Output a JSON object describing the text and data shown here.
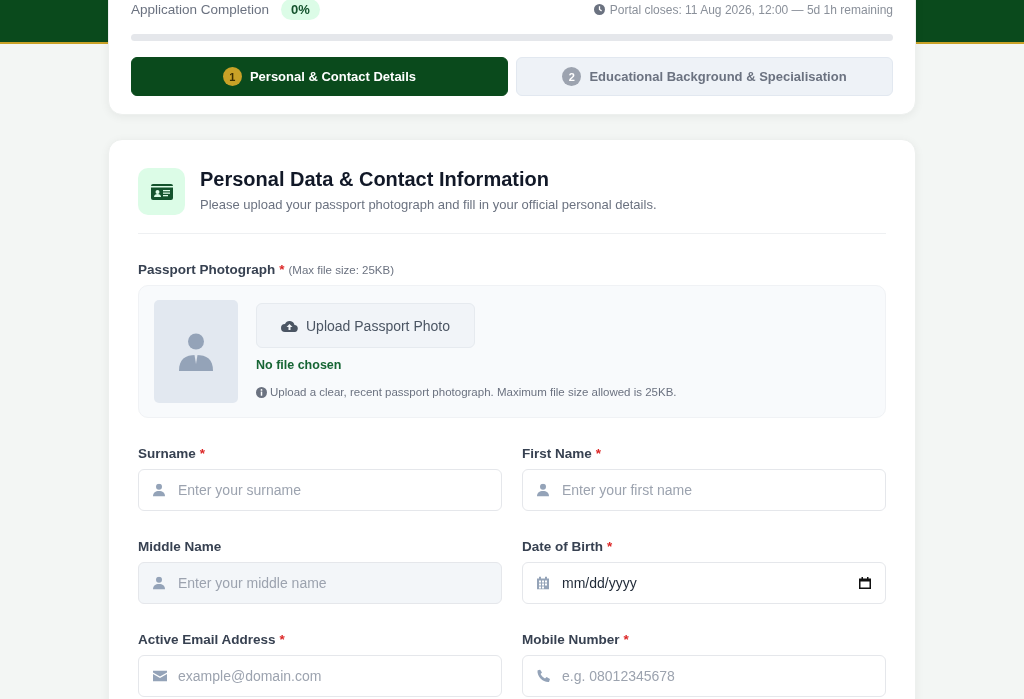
{
  "progress": {
    "label": "Application Completion",
    "percent": "0%",
    "level": 0,
    "deadline": "Portal closes: 11 Aug 2026, 12:00 — 5d 1h remaining"
  },
  "steps": [
    {
      "number": "1",
      "label": "Personal & Contact Details",
      "selected": true
    },
    {
      "number": "2",
      "label": "Educational Background & Specialisation",
      "selected": false
    }
  ],
  "section": {
    "title": "Personal Data & Contact Information",
    "subtitle": "Please upload your passport photograph and fill in your official personal details."
  },
  "passport": {
    "label": "Passport Photograph",
    "required_mark": "*",
    "note": "(Max file size: 25KB)",
    "button": "Upload Passport Photo",
    "status": "No file chosen",
    "hint": "Upload a clear, recent passport photograph. Maximum file size allowed is 25KB."
  },
  "fields": [
    {
      "kind": "person",
      "label": "Surname",
      "required_mark": "*",
      "placeholder": "Enter your surname",
      "shaded": false
    },
    {
      "kind": "person",
      "label": "First Name",
      "required_mark": "*",
      "placeholder": "Enter your first name",
      "shaded": false
    },
    {
      "kind": "person",
      "label": "Middle Name",
      "placeholder": "Enter your middle name",
      "shaded": true
    },
    {
      "kind": "date",
      "label": "Date of Birth",
      "required_mark": "*",
      "placeholder": "mm/dd/yyyy",
      "shaded": false
    },
    {
      "kind": "email",
      "label": "Active Email Address",
      "required_mark": "*",
      "placeholder": "example@domain.com",
      "shaded": false
    },
    {
      "kind": "phone",
      "label": "Mobile Number",
      "required_mark": "*",
      "placeholder": "e.g. 08012345678",
      "shaded": false
    }
  ]
}
